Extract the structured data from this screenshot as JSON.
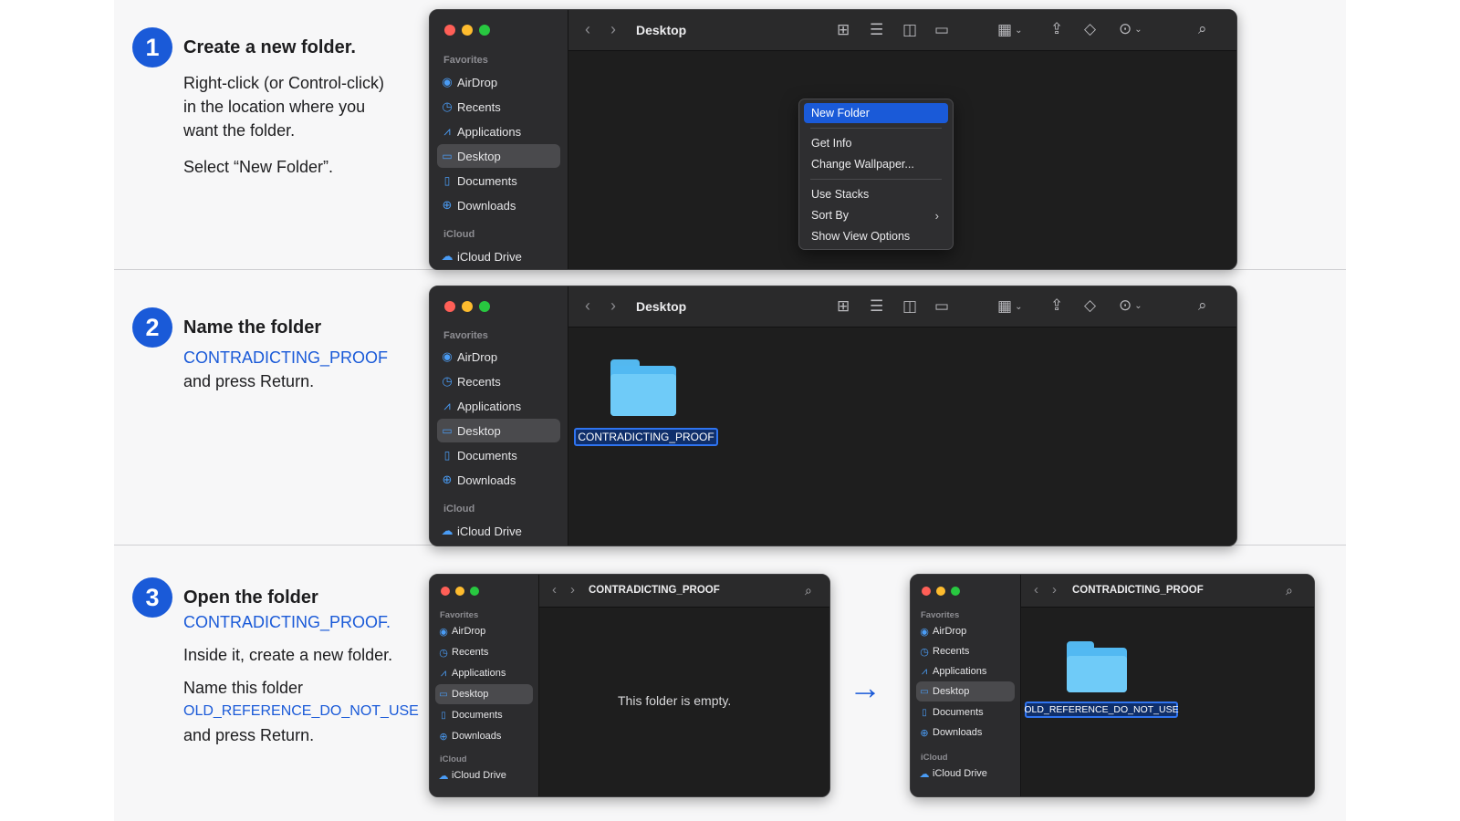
{
  "steps": [
    {
      "num": "1",
      "title": "Create a new folder.",
      "lines": [
        "Right-click (or Control-click)",
        "in the location where you",
        "want the folder."
      ],
      "line2": "Select “New Folder”."
    },
    {
      "num": "2",
      "title": "Name the folder",
      "highlight": "CONTRADICTING_PROOF",
      "tail": "and press Return."
    },
    {
      "num": "3",
      "title": "Open the folder",
      "highlight": "CONTRADICTING_PROOF.",
      "line_a": "Inside it, create a new folder.",
      "line_b": "Name this folder",
      "highlight2": "OLD_REFERENCE_DO_NOT_USE",
      "tail": "and press Return."
    }
  ],
  "sidebar": {
    "favorites_label": "Favorites",
    "icloud_label": "iCloud",
    "items": [
      "AirDrop",
      "Recents",
      "Applications",
      "Desktop",
      "Documents",
      "Downloads"
    ],
    "icloud_item": "iCloud Drive"
  },
  "windows": {
    "w1_title": "Desktop",
    "w2_title": "Desktop",
    "w3_title": "CONTRADICTING_PROOF",
    "w4_title": "CONTRADICTING_PROOF"
  },
  "context_menu": {
    "items": [
      "New Folder",
      "Get Info",
      "Change Wallpaper...",
      "Use Stacks",
      "Sort By",
      "Show View Options"
    ]
  },
  "folder_names": {
    "w2": "CONTRADICTING_PROOF",
    "w4": "OLD_REFERENCE_DO_NOT_USE"
  },
  "empty_text": "This folder is empty.",
  "arrow": "→",
  "colors": {
    "accent": "#1a5ad8",
    "window_bg": "#1e1e1e",
    "sidebar_bg": "#2c2c2e",
    "folder": "#52b9f2"
  }
}
